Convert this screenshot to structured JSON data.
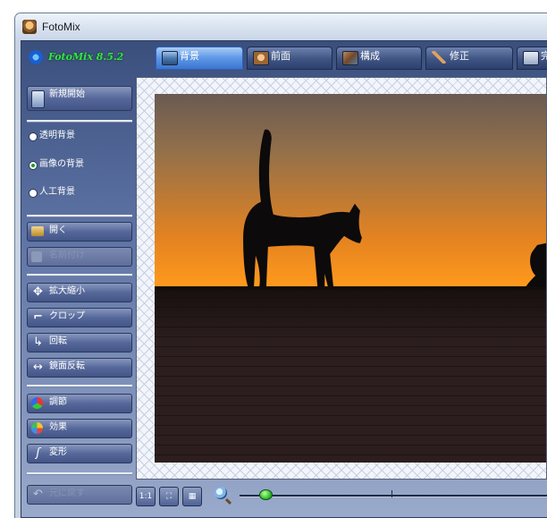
{
  "window": {
    "title": "FotoMix"
  },
  "header": {
    "version": "FotoMix 8.5.2"
  },
  "tabs": [
    {
      "label": "背景",
      "active": true,
      "icon": "background-tab-icon"
    },
    {
      "label": "前面",
      "active": false,
      "icon": "foreground-tab-icon"
    },
    {
      "label": "構成",
      "active": false,
      "icon": "compose-tab-icon"
    },
    {
      "label": "修正",
      "active": false,
      "icon": "retouch-tab-icon"
    },
    {
      "label": "完了",
      "active": false,
      "icon": "finish-tab-icon"
    }
  ],
  "sidebar": {
    "new_start": "新規開始",
    "background_options": [
      {
        "label": "透明背景",
        "selected": false
      },
      {
        "label": "画像の背景",
        "selected": true
      },
      {
        "label": "人工背景",
        "selected": false
      }
    ],
    "open": "開く",
    "save": "名前付け",
    "zoom": "拡大縮小",
    "crop": "クロップ",
    "rotate": "回転",
    "mirror": "鏡面反転",
    "adjust": "調節",
    "effects": "効果",
    "transform": "変形",
    "undo": "元に戻す"
  },
  "bottom_bar": {
    "actual_size": "1:1",
    "zoom_level": 0.06
  },
  "colors": {
    "accent_tab": "#5d97e6",
    "version_text": "#33e24a",
    "sky_top": "#6a5a52",
    "sky_bottom": "#ff9a1c",
    "wall": "#2c1e1e"
  }
}
